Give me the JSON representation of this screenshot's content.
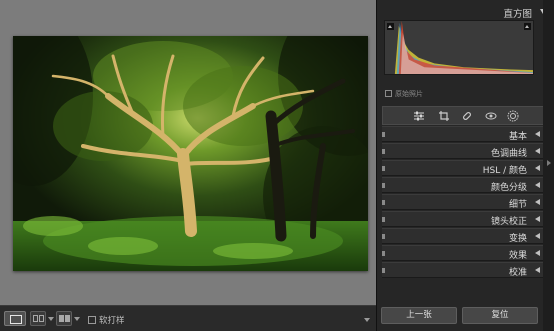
{
  "panel": {
    "histogram_title": "直方图",
    "original_photo_label": "原始照片",
    "sections": [
      {
        "label": "基本"
      },
      {
        "label": "色调曲线"
      },
      {
        "label": "HSL / 颜色"
      },
      {
        "label": "颜色分级"
      },
      {
        "label": "细节"
      },
      {
        "label": "镜头校正"
      },
      {
        "label": "变换"
      },
      {
        "label": "效果"
      },
      {
        "label": "校准"
      }
    ],
    "tools": [
      {
        "icon": "sliders-icon"
      },
      {
        "icon": "crop-icon"
      },
      {
        "icon": "healing-brush-icon"
      },
      {
        "icon": "red-eye-icon"
      },
      {
        "icon": "masking-icon"
      }
    ],
    "prev_label": "上一张",
    "reset_label": "复位"
  },
  "toolbar": {
    "soft_proof_label": "软打样",
    "view_modes": [
      {
        "icon": "loupe-view-icon",
        "selected": true
      },
      {
        "icon": "compare-view-icon"
      },
      {
        "icon": "survey-view-icon"
      }
    ]
  },
  "photo": {
    "subject": "forest-tree-photo"
  },
  "colors": {
    "background_canvas": "#7c7c7c",
    "panel_bg": "#262626",
    "histogram_red": "#e0462a",
    "histogram_blue": "#3fa0e0",
    "histogram_yellow": "#e2d23a"
  }
}
